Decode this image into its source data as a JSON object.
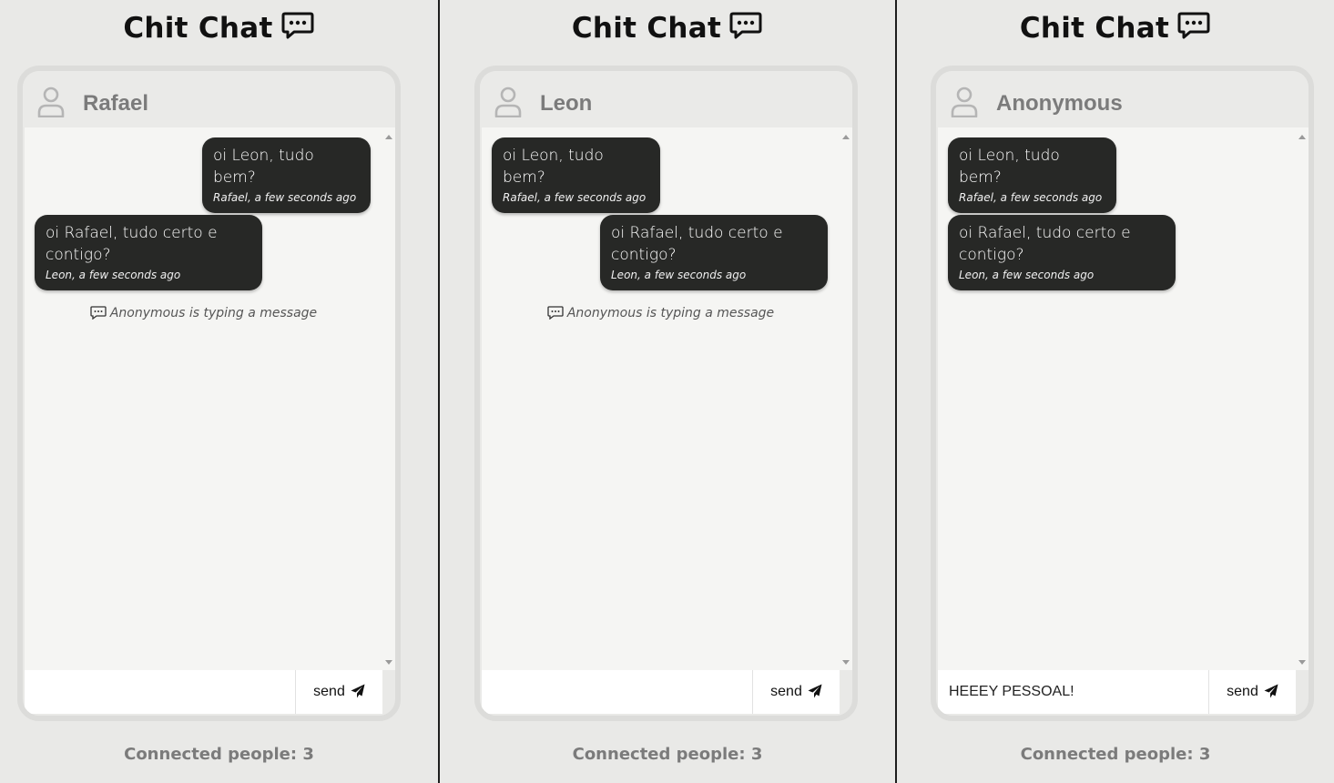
{
  "app": {
    "title": "Chit Chat",
    "title_icon": "speech-bubble-dots-icon"
  },
  "panels": [
    {
      "user_name": "Rafael",
      "messages": [
        {
          "text": "oi Leon, tudo bem?",
          "meta": "Rafael, a few seconds ago",
          "own": true
        },
        {
          "text": "oi Rafael, tudo certo e contigo?",
          "meta": "Leon, a few seconds ago",
          "own": false
        }
      ],
      "typing_text": "Anonymous is typing a message",
      "input_value": "",
      "send_label": "send",
      "connected_text": "Connected people: 3"
    },
    {
      "user_name": "Leon",
      "messages": [
        {
          "text": "oi Leon, tudo bem?",
          "meta": "Rafael, a few seconds ago",
          "own": false
        },
        {
          "text": "oi Rafael, tudo certo e contigo?",
          "meta": "Leon, a few seconds ago",
          "own": true
        }
      ],
      "typing_text": "Anonymous is typing a message",
      "input_value": "",
      "send_label": "send",
      "connected_text": "Connected people: 3"
    },
    {
      "user_name": "Anonymous",
      "messages": [
        {
          "text": "oi Leon, tudo bem?",
          "meta": "Rafael, a few seconds ago",
          "own": false
        },
        {
          "text": "oi Rafael, tudo certo e contigo?",
          "meta": "Leon, a few seconds ago",
          "own": false
        }
      ],
      "typing_text": "",
      "input_value": "HEEEY PESSOAL!",
      "send_label": "send",
      "connected_text": "Connected people: 3"
    }
  ],
  "colors": {
    "bubble": "#272826",
    "background": "#e9e9e7",
    "muted_text": "#7b7b7b"
  }
}
